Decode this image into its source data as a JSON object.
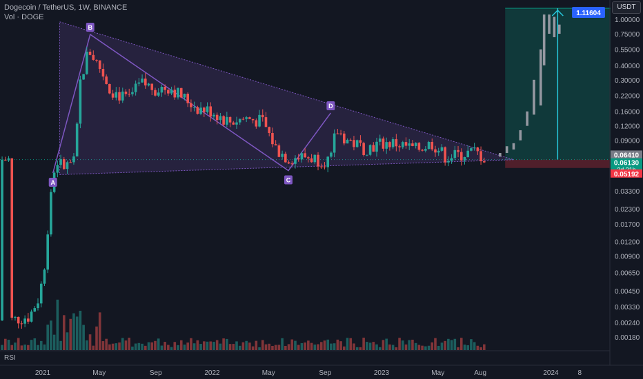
{
  "header": {
    "symbol_line": "Dogecoin / TetherUS, 1W, BINANCE",
    "volume_label": "Vol · DOGE"
  },
  "price_axis": {
    "currency_button": "USDT",
    "ticks": [
      "1.00000",
      "0.75000",
      "0.55000",
      "0.40000",
      "0.30000",
      "0.22000",
      "0.16000",
      "0.12000",
      "0.09000",
      "0.03300",
      "0.02300",
      "0.01700",
      "0.01200",
      "0.00900",
      "0.00650",
      "0.00450",
      "0.00330",
      "0.00240",
      "0.00180"
    ],
    "badges": [
      {
        "id": "target",
        "text": "1.11604",
        "value": 1.11604,
        "color": "#2962ff"
      },
      {
        "id": "upper",
        "text": "0.06410",
        "value": 0.0641,
        "color": "#787b86"
      },
      {
        "id": "current",
        "text": "0.06130",
        "value": 0.0613,
        "color": "#089981",
        "sub": "3d 21h"
      },
      {
        "id": "stop",
        "text": "0.05192",
        "value": 0.05192,
        "color": "#f23645"
      }
    ]
  },
  "time_axis": {
    "labels": [
      {
        "text": "2021",
        "t": 0.0
      },
      {
        "text": "May",
        "t": 0.333
      },
      {
        "text": "Sep",
        "t": 0.667
      },
      {
        "text": "2022",
        "t": 1.0
      },
      {
        "text": "May",
        "t": 1.333
      },
      {
        "text": "Sep",
        "t": 1.667
      },
      {
        "text": "2023",
        "t": 2.0
      },
      {
        "text": "May",
        "t": 2.333
      },
      {
        "text": "Aug",
        "t": 2.583
      },
      {
        "text": "2024",
        "t": 3.0
      },
      {
        "text": "8",
        "t": 3.17
      }
    ]
  },
  "rsi_label": "RSI",
  "pattern_points": [
    {
      "label": "A",
      "t": 0.06,
      "price": 0.047
    },
    {
      "label": "B",
      "t": 0.28,
      "price": 0.74
    },
    {
      "label": "C",
      "t": 1.45,
      "price": 0.0493
    },
    {
      "label": "D",
      "t": 1.7,
      "price": 0.155
    }
  ],
  "colors": {
    "background": "#131722",
    "up": "#26a69a",
    "down": "#ef5350",
    "pattern": "#7e57c2",
    "long_profit": "#089981",
    "long_loss": "#f23645",
    "projection": "#9598a1"
  },
  "chart_data": {
    "type": "candlestick",
    "title": "Dogecoin / TetherUS, 1W, BINANCE",
    "xlabel": "",
    "ylabel": "",
    "y_scale": "log",
    "ylim": [
      0.0015,
      1.15
    ],
    "x_range": [
      "2020-09",
      "2024-03"
    ],
    "series": [
      {
        "name": "price_close_approx",
        "points": [
          {
            "date": "2020-11",
            "value": 0.0027
          },
          {
            "date": "2020-12",
            "value": 0.0045
          },
          {
            "date": "2021-01",
            "value": 0.0095
          },
          {
            "date": "2021-01-28",
            "value": 0.035
          },
          {
            "date": "2021-02",
            "value": 0.055
          },
          {
            "date": "2021-03",
            "value": 0.055
          },
          {
            "date": "2021-04",
            "value": 0.3
          },
          {
            "date": "2021-05",
            "value": 0.5
          },
          {
            "date": "2021-06",
            "value": 0.3
          },
          {
            "date": "2021-07",
            "value": 0.2
          },
          {
            "date": "2021-08",
            "value": 0.28
          },
          {
            "date": "2021-09",
            "value": 0.22
          },
          {
            "date": "2021-10",
            "value": 0.26
          },
          {
            "date": "2021-11",
            "value": 0.22
          },
          {
            "date": "2021-12",
            "value": 0.17
          },
          {
            "date": "2022-01",
            "value": 0.14
          },
          {
            "date": "2022-02",
            "value": 0.13
          },
          {
            "date": "2022-03",
            "value": 0.13
          },
          {
            "date": "2022-04",
            "value": 0.14
          },
          {
            "date": "2022-05",
            "value": 0.08
          },
          {
            "date": "2022-06",
            "value": 0.06
          },
          {
            "date": "2022-07",
            "value": 0.065
          },
          {
            "date": "2022-08",
            "value": 0.07
          },
          {
            "date": "2022-09",
            "value": 0.06
          },
          {
            "date": "2022-10",
            "value": 0.06
          },
          {
            "date": "2022-11",
            "value": 0.09
          },
          {
            "date": "2022-12",
            "value": 0.075
          },
          {
            "date": "2023-01",
            "value": 0.085
          },
          {
            "date": "2023-02",
            "value": 0.085
          },
          {
            "date": "2023-03",
            "value": 0.075
          },
          {
            "date": "2023-04",
            "value": 0.085
          },
          {
            "date": "2023-05",
            "value": 0.073
          },
          {
            "date": "2023-06",
            "value": 0.063
          },
          {
            "date": "2023-07",
            "value": 0.072
          },
          {
            "date": "2023-08",
            "value": 0.0613
          }
        ]
      },
      {
        "name": "projection",
        "points": [
          {
            "date": "2023-09",
            "value": 0.065
          },
          {
            "date": "2023-10",
            "value": 0.09
          },
          {
            "date": "2023-11",
            "value": 0.15
          },
          {
            "date": "2023-12",
            "value": 0.45
          },
          {
            "date": "2023-12-20",
            "value": 1.1
          },
          {
            "date": "2024-01",
            "value": 0.75
          }
        ]
      }
    ],
    "annotations": [
      {
        "label": "A",
        "value": 0.047
      },
      {
        "label": "B",
        "value": 0.74
      },
      {
        "label": "C",
        "value": 0.0493
      },
      {
        "label": "D",
        "value": 0.155
      }
    ],
    "long_position": {
      "entry": 0.0613,
      "target": 1.11604,
      "stop": 0.05192
    }
  }
}
